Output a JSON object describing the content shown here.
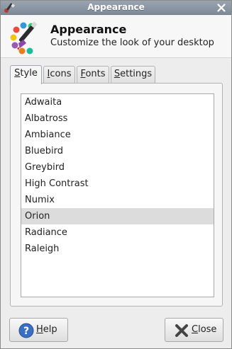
{
  "window": {
    "title": "Appearance"
  },
  "header": {
    "title": "Appearance",
    "subtitle": "Customize the look of your desktop"
  },
  "tabs": [
    {
      "label_ul": "S",
      "label_rest": "tyle",
      "active": true
    },
    {
      "label_ul": "I",
      "label_rest": "cons",
      "active": false
    },
    {
      "label_ul": "F",
      "label_rest": "onts",
      "active": false
    },
    {
      "label_ul": "S",
      "label_rest": "ettings",
      "active": false
    }
  ],
  "theme_list": {
    "items": [
      "Adwaita",
      "Albatross",
      "Ambiance",
      "Bluebird",
      "Greybird",
      "High Contrast",
      "Numix",
      "Orion",
      "Radiance",
      "Raleigh"
    ],
    "selected": "Orion"
  },
  "buttons": {
    "help_ul": "H",
    "help_rest": "elp",
    "close_ul": "C",
    "close_rest": "lose"
  },
  "colors": {
    "titlebar": "#8a95a3",
    "selection": "#dcdcdc",
    "help_icon": "#3b6fc4",
    "close_icon": "#555555"
  }
}
